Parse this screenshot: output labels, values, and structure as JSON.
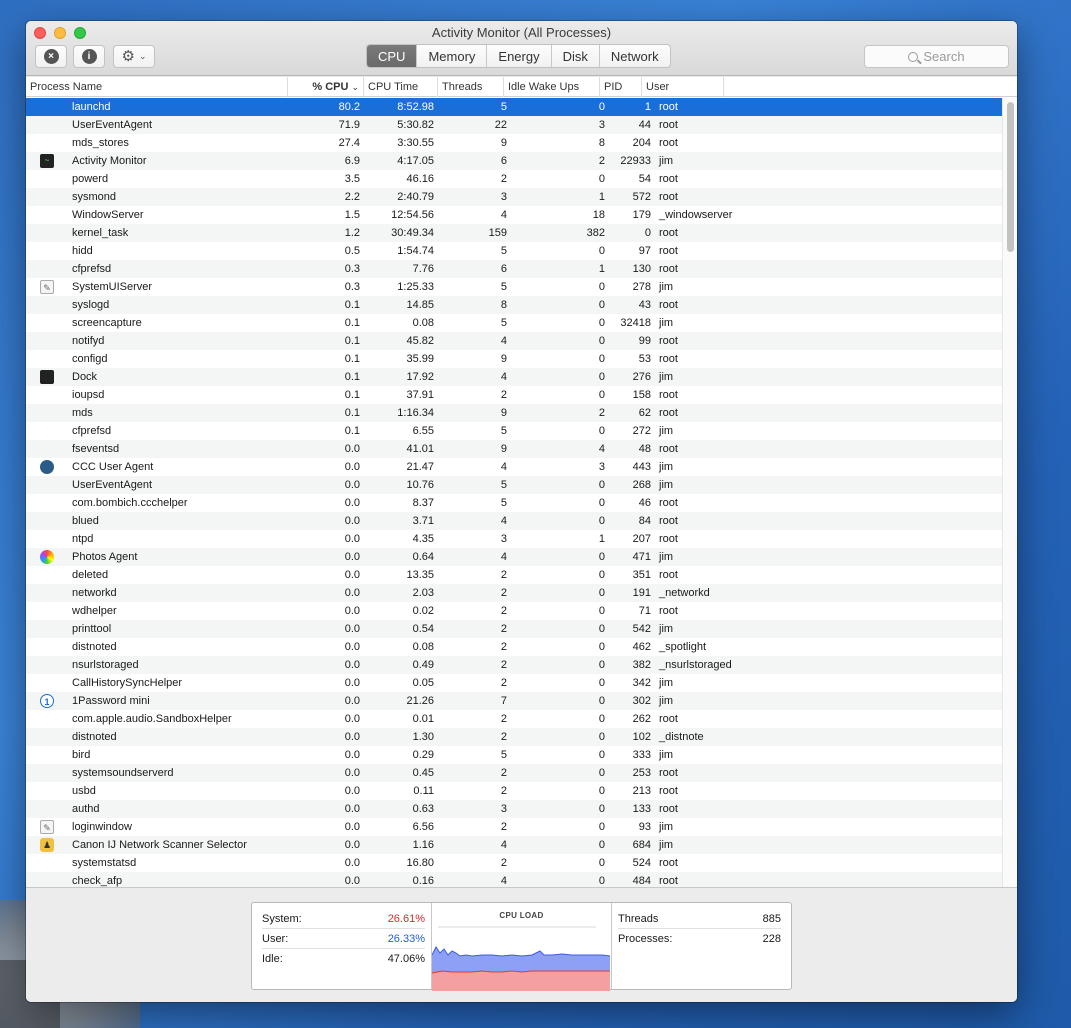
{
  "window": {
    "title": "Activity Monitor (All Processes)"
  },
  "toolbar": {
    "stop_icon": "×",
    "info_icon": "i",
    "gear_icon": "⚙",
    "chevron_icon": "⌄",
    "tabs": [
      {
        "label": "CPU",
        "active": true
      },
      {
        "label": "Memory",
        "active": false
      },
      {
        "label": "Energy",
        "active": false
      },
      {
        "label": "Disk",
        "active": false
      },
      {
        "label": "Network",
        "active": false
      }
    ],
    "search_placeholder": "Search"
  },
  "columns": {
    "name": "Process Name",
    "cpu": "% CPU",
    "cpu_sort": "⌄",
    "time": "CPU Time",
    "threads": "Threads",
    "idle": "Idle Wake Ups",
    "pid": "PID",
    "user": "User"
  },
  "processes": [
    {
      "icon": "",
      "name": "launchd",
      "cpu": "80.2",
      "time": "8:52.98",
      "threads": "5",
      "idle": "0",
      "pid": "1",
      "user": "root",
      "selected": true
    },
    {
      "icon": "",
      "name": "UserEventAgent",
      "cpu": "71.9",
      "time": "5:30.82",
      "threads": "22",
      "idle": "3",
      "pid": "44",
      "user": "root"
    },
    {
      "icon": "",
      "name": "mds_stores",
      "cpu": "27.4",
      "time": "3:30.55",
      "threads": "9",
      "idle": "8",
      "pid": "204",
      "user": "root"
    },
    {
      "icon": "activity-monitor",
      "name": "Activity Monitor",
      "cpu": "6.9",
      "time": "4:17.05",
      "threads": "6",
      "idle": "2",
      "pid": "22933",
      "user": "jim"
    },
    {
      "icon": "",
      "name": "powerd",
      "cpu": "3.5",
      "time": "46.16",
      "threads": "2",
      "idle": "0",
      "pid": "54",
      "user": "root"
    },
    {
      "icon": "",
      "name": "sysmond",
      "cpu": "2.2",
      "time": "2:40.79",
      "threads": "3",
      "idle": "1",
      "pid": "572",
      "user": "root"
    },
    {
      "icon": "",
      "name": "WindowServer",
      "cpu": "1.5",
      "time": "12:54.56",
      "threads": "4",
      "idle": "18",
      "pid": "179",
      "user": "_windowserver"
    },
    {
      "icon": "",
      "name": "kernel_task",
      "cpu": "1.2",
      "time": "30:49.34",
      "threads": "159",
      "idle": "382",
      "pid": "0",
      "user": "root"
    },
    {
      "icon": "",
      "name": "hidd",
      "cpu": "0.5",
      "time": "1:54.74",
      "threads": "5",
      "idle": "0",
      "pid": "97",
      "user": "root"
    },
    {
      "icon": "",
      "name": "cfprefsd",
      "cpu": "0.3",
      "time": "7.76",
      "threads": "6",
      "idle": "1",
      "pid": "130",
      "user": "root"
    },
    {
      "icon": "doc",
      "name": "SystemUIServer",
      "cpu": "0.3",
      "time": "1:25.33",
      "threads": "5",
      "idle": "0",
      "pid": "278",
      "user": "jim"
    },
    {
      "icon": "",
      "name": "syslogd",
      "cpu": "0.1",
      "time": "14.85",
      "threads": "8",
      "idle": "0",
      "pid": "43",
      "user": "root"
    },
    {
      "icon": "",
      "name": "screencapture",
      "cpu": "0.1",
      "time": "0.08",
      "threads": "5",
      "idle": "0",
      "pid": "32418",
      "user": "jim"
    },
    {
      "icon": "",
      "name": "notifyd",
      "cpu": "0.1",
      "time": "45.82",
      "threads": "4",
      "idle": "0",
      "pid": "99",
      "user": "root"
    },
    {
      "icon": "",
      "name": "configd",
      "cpu": "0.1",
      "time": "35.99",
      "threads": "9",
      "idle": "0",
      "pid": "53",
      "user": "root"
    },
    {
      "icon": "dock",
      "name": "Dock",
      "cpu": "0.1",
      "time": "17.92",
      "threads": "4",
      "idle": "0",
      "pid": "276",
      "user": "jim"
    },
    {
      "icon": "",
      "name": "ioupsd",
      "cpu": "0.1",
      "time": "37.91",
      "threads": "2",
      "idle": "0",
      "pid": "158",
      "user": "root"
    },
    {
      "icon": "",
      "name": "mds",
      "cpu": "0.1",
      "time": "1:16.34",
      "threads": "9",
      "idle": "2",
      "pid": "62",
      "user": "root"
    },
    {
      "icon": "",
      "name": "cfprefsd",
      "cpu": "0.1",
      "time": "6.55",
      "threads": "5",
      "idle": "0",
      "pid": "272",
      "user": "jim"
    },
    {
      "icon": "",
      "name": "fseventsd",
      "cpu": "0.0",
      "time": "41.01",
      "threads": "9",
      "idle": "4",
      "pid": "48",
      "user": "root"
    },
    {
      "icon": "ccc",
      "name": "CCC User Agent",
      "cpu": "0.0",
      "time": "21.47",
      "threads": "4",
      "idle": "3",
      "pid": "443",
      "user": "jim"
    },
    {
      "icon": "",
      "name": "UserEventAgent",
      "cpu": "0.0",
      "time": "10.76",
      "threads": "5",
      "idle": "0",
      "pid": "268",
      "user": "jim"
    },
    {
      "icon": "",
      "name": "com.bombich.ccchelper",
      "cpu": "0.0",
      "time": "8.37",
      "threads": "5",
      "idle": "0",
      "pid": "46",
      "user": "root"
    },
    {
      "icon": "",
      "name": "blued",
      "cpu": "0.0",
      "time": "3.71",
      "threads": "4",
      "idle": "0",
      "pid": "84",
      "user": "root"
    },
    {
      "icon": "",
      "name": "ntpd",
      "cpu": "0.0",
      "time": "4.35",
      "threads": "3",
      "idle": "1",
      "pid": "207",
      "user": "root"
    },
    {
      "icon": "photos",
      "name": "Photos Agent",
      "cpu": "0.0",
      "time": "0.64",
      "threads": "4",
      "idle": "0",
      "pid": "471",
      "user": "jim"
    },
    {
      "icon": "",
      "name": "deleted",
      "cpu": "0.0",
      "time": "13.35",
      "threads": "2",
      "idle": "0",
      "pid": "351",
      "user": "root"
    },
    {
      "icon": "",
      "name": "networkd",
      "cpu": "0.0",
      "time": "2.03",
      "threads": "2",
      "idle": "0",
      "pid": "191",
      "user": "_networkd"
    },
    {
      "icon": "",
      "name": "wdhelper",
      "cpu": "0.0",
      "time": "0.02",
      "threads": "2",
      "idle": "0",
      "pid": "71",
      "user": "root"
    },
    {
      "icon": "",
      "name": "printtool",
      "cpu": "0.0",
      "time": "0.54",
      "threads": "2",
      "idle": "0",
      "pid": "542",
      "user": "jim"
    },
    {
      "icon": "",
      "name": "distnoted",
      "cpu": "0.0",
      "time": "0.08",
      "threads": "2",
      "idle": "0",
      "pid": "462",
      "user": "_spotlight"
    },
    {
      "icon": "",
      "name": "nsurlstoraged",
      "cpu": "0.0",
      "time": "0.49",
      "threads": "2",
      "idle": "0",
      "pid": "382",
      "user": "_nsurlstoraged"
    },
    {
      "icon": "",
      "name": "CallHistorySyncHelper",
      "cpu": "0.0",
      "time": "0.05",
      "threads": "2",
      "idle": "0",
      "pid": "342",
      "user": "jim"
    },
    {
      "icon": "1password",
      "name": "1Password mini",
      "cpu": "0.0",
      "time": "21.26",
      "threads": "7",
      "idle": "0",
      "pid": "302",
      "user": "jim"
    },
    {
      "icon": "",
      "name": "com.apple.audio.SandboxHelper",
      "cpu": "0.0",
      "time": "0.01",
      "threads": "2",
      "idle": "0",
      "pid": "262",
      "user": "root"
    },
    {
      "icon": "",
      "name": "distnoted",
      "cpu": "0.0",
      "time": "1.30",
      "threads": "2",
      "idle": "0",
      "pid": "102",
      "user": "_distnote"
    },
    {
      "icon": "",
      "name": "bird",
      "cpu": "0.0",
      "time": "0.29",
      "threads": "5",
      "idle": "0",
      "pid": "333",
      "user": "jim"
    },
    {
      "icon": "",
      "name": "systemsoundserverd",
      "cpu": "0.0",
      "time": "0.45",
      "threads": "2",
      "idle": "0",
      "pid": "253",
      "user": "root"
    },
    {
      "icon": "",
      "name": "usbd",
      "cpu": "0.0",
      "time": "0.11",
      "threads": "2",
      "idle": "0",
      "pid": "213",
      "user": "root"
    },
    {
      "icon": "",
      "name": "authd",
      "cpu": "0.0",
      "time": "0.63",
      "threads": "3",
      "idle": "0",
      "pid": "133",
      "user": "root"
    },
    {
      "icon": "doc",
      "name": "loginwindow",
      "cpu": "0.0",
      "time": "6.56",
      "threads": "2",
      "idle": "0",
      "pid": "93",
      "user": "jim"
    },
    {
      "icon": "canon",
      "name": "Canon IJ Network Scanner Selector",
      "cpu": "0.0",
      "time": "1.16",
      "threads": "4",
      "idle": "0",
      "pid": "684",
      "user": "jim"
    },
    {
      "icon": "",
      "name": "systemstatsd",
      "cpu": "0.0",
      "time": "16.80",
      "threads": "2",
      "idle": "0",
      "pid": "524",
      "user": "root"
    },
    {
      "icon": "",
      "name": "check_afp",
      "cpu": "0.0",
      "time": "0.16",
      "threads": "4",
      "idle": "0",
      "pid": "484",
      "user": "root"
    }
  ],
  "footer": {
    "system_label": "System:",
    "system_value": "26.61%",
    "user_label": "User:",
    "user_value": "26.33%",
    "idle_label": "Idle:",
    "idle_value": "47.06%",
    "graph_title": "CPU LOAD",
    "threads_label": "Threads",
    "threads_value": "885",
    "processes_label": "Processes:",
    "processes_value": "228"
  },
  "colors": {
    "selection": "#1a6ed8",
    "system": "#e5262a",
    "user": "#1c5fd8"
  }
}
